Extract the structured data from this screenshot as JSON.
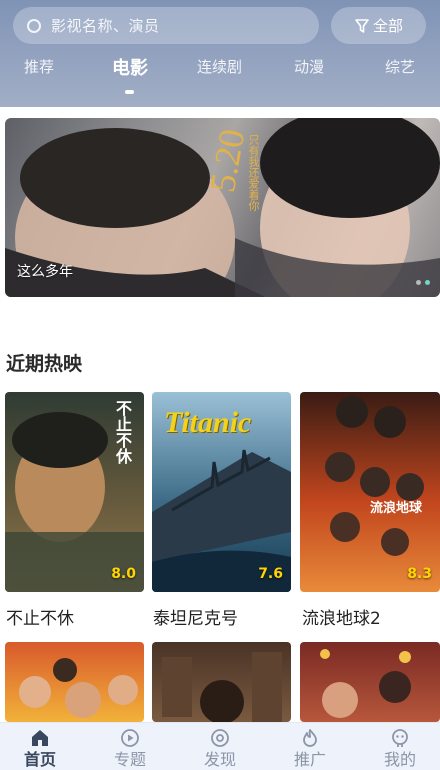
{
  "search": {
    "placeholder": "影视名称、演员",
    "filter_label": "全部"
  },
  "tabs": [
    {
      "label": "推荐",
      "active": false
    },
    {
      "label": "电影",
      "active": true
    },
    {
      "label": "连续剧",
      "active": false
    },
    {
      "label": "动漫",
      "active": false
    },
    {
      "label": "综艺",
      "active": false
    }
  ],
  "banner": {
    "caption": "这么多年",
    "poster_text": "5.20",
    "poster_subtext": "只有我还爱着你",
    "slides": 2,
    "active_slide": 2
  },
  "section": {
    "title": "近期热映",
    "movies": [
      {
        "title": "不止不休",
        "score": "8.0",
        "poster_text": "不止不休"
      },
      {
        "title": "泰坦尼克号",
        "score": "7.6",
        "poster_text": "Titanic"
      },
      {
        "title": "流浪地球2",
        "score": "8.3",
        "poster_text": "流浪地球"
      }
    ]
  },
  "bottom_nav": [
    {
      "label": "首页",
      "icon": "home-icon",
      "active": true
    },
    {
      "label": "专题",
      "icon": "play-circle-icon",
      "active": false
    },
    {
      "label": "发现",
      "icon": "discover-icon",
      "active": false
    },
    {
      "label": "推广",
      "icon": "flame-icon",
      "active": false
    },
    {
      "label": "我的",
      "icon": "user-icon",
      "active": false
    }
  ],
  "colors": {
    "header": "#8a9bba",
    "accent": "#6fd6c9",
    "score": "#ffd400",
    "nav_bg": "#eef2fa"
  }
}
